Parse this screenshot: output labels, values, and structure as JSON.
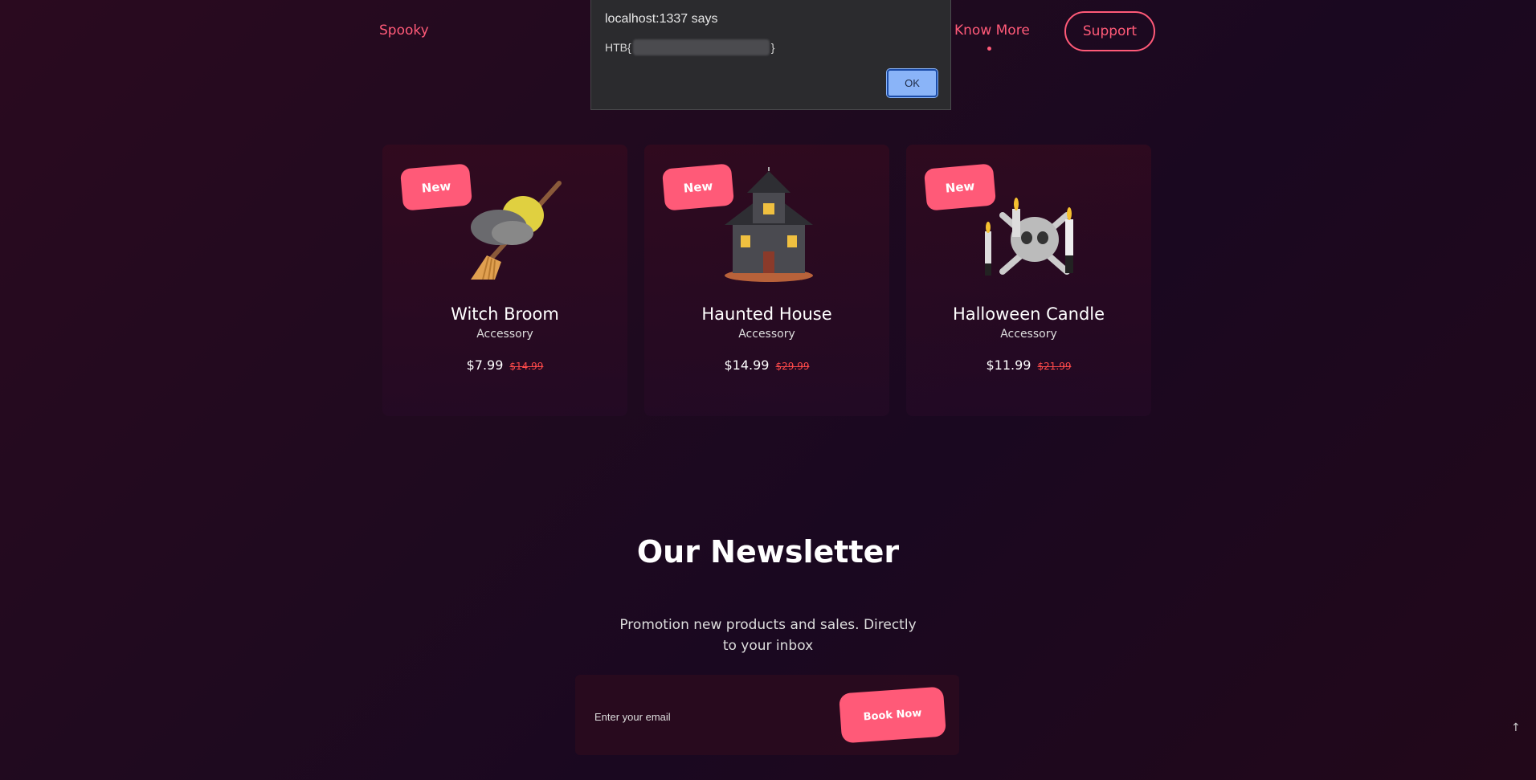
{
  "nav": {
    "brand": "Spooky",
    "link": "Know More",
    "support": "Support"
  },
  "alert": {
    "title": "localhost:1337 says",
    "message_prefix": "HTB{",
    "message_suffix": "}",
    "ok_label": "OK"
  },
  "products": [
    {
      "badge": "New",
      "title": "Witch Broom",
      "category": "Accessory",
      "price": "$7.99",
      "old_price": "$14.99",
      "icon": "witch-broom-icon"
    },
    {
      "badge": "New",
      "title": "Haunted House",
      "category": "Accessory",
      "price": "$14.99",
      "old_price": "$29.99",
      "icon": "haunted-house-icon"
    },
    {
      "badge": "New",
      "title": "Halloween Candle",
      "category": "Accessory",
      "price": "$11.99",
      "old_price": "$21.99",
      "icon": "skull-candle-icon"
    }
  ],
  "newsletter": {
    "title": "Our Newsletter",
    "description": "Promotion new products and sales. Directly to your inbox",
    "email_placeholder": "Enter your email",
    "button": "Book Now"
  },
  "scroll_top": "↑",
  "colors": {
    "accent": "#ff5a78",
    "old_price": "#ff4a4a",
    "dialog_bg": "#2b2b2e",
    "ok_button": "#8ab4f8"
  }
}
